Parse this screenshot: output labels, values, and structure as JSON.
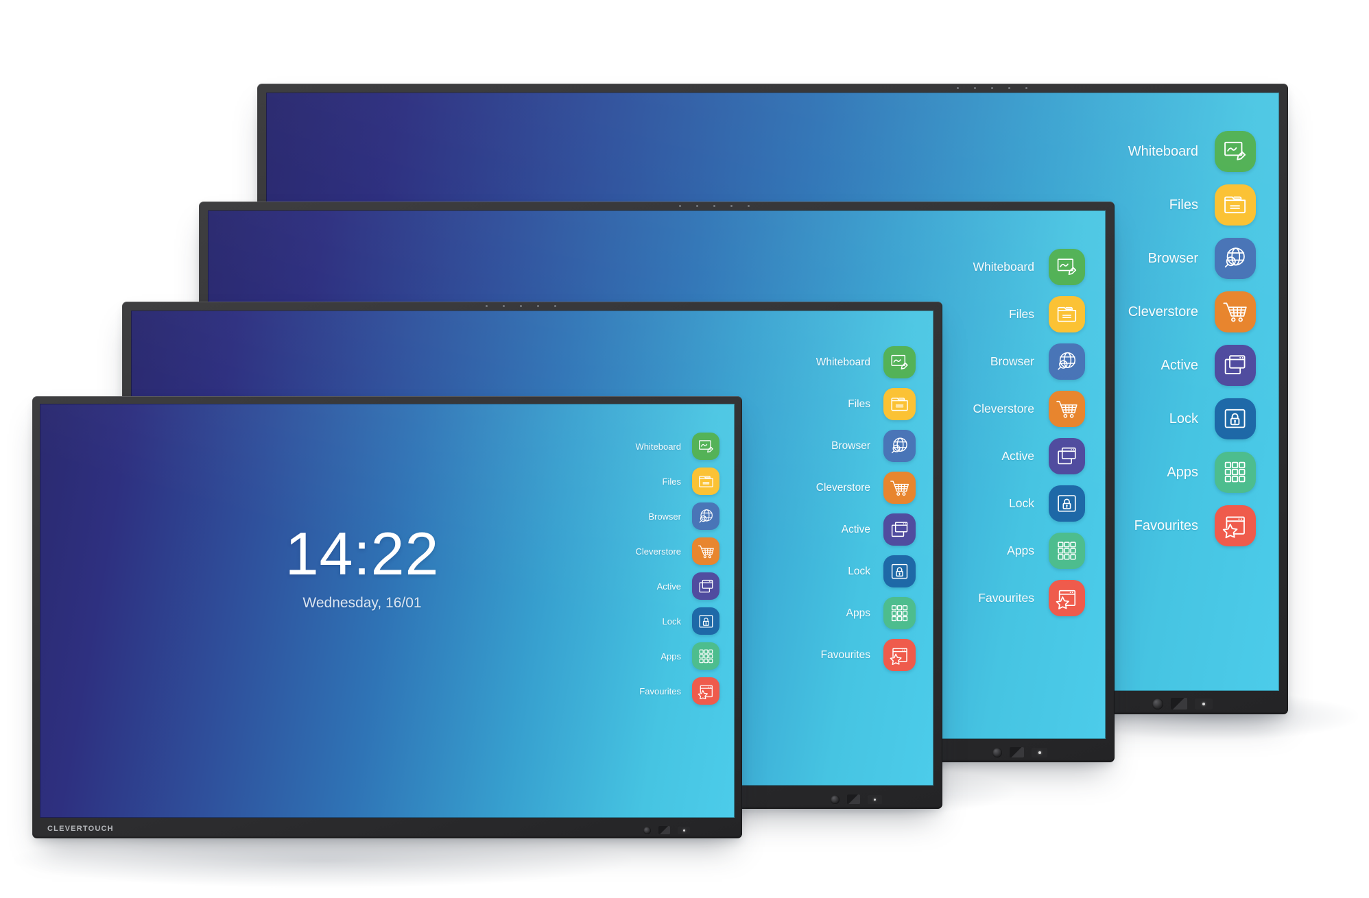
{
  "product": {
    "brand": "CLEVERTOUCH"
  },
  "lockscreen": {
    "time": "14:22",
    "date": "Wednesday, 16/01"
  },
  "menu": {
    "items": [
      {
        "label": "Whiteboard",
        "icon": "whiteboard-icon",
        "color": "#4caf50"
      },
      {
        "label": "Files",
        "icon": "folder-icon",
        "color": "#fbc02d"
      },
      {
        "label": "Browser",
        "icon": "globe-search-icon",
        "color": "#4471b5"
      },
      {
        "label": "Cleverstore",
        "icon": "shopping-cart-icon",
        "color": "#e8832a"
      },
      {
        "label": "Active",
        "icon": "windows-stack-icon",
        "color": "#4e4a9e"
      },
      {
        "label": "Lock",
        "icon": "lock-icon",
        "color": "#1d68a7"
      },
      {
        "label": "Apps",
        "icon": "grid-apps-icon",
        "color": "#4dbd8e"
      },
      {
        "label": "Favourites",
        "icon": "star-window-icon",
        "color": "#ef5b4c"
      }
    ]
  },
  "displays": [
    {
      "name": "display-largest",
      "size_index": 4
    },
    {
      "name": "display-large",
      "size_index": 3
    },
    {
      "name": "display-medium",
      "size_index": 2
    },
    {
      "name": "display-front",
      "size_index": 1
    }
  ],
  "colors": {
    "screen_gradient_start": "#2b2a70",
    "screen_gradient_end": "#4cccea",
    "bezel": "#333335",
    "background": "#ffffff"
  }
}
